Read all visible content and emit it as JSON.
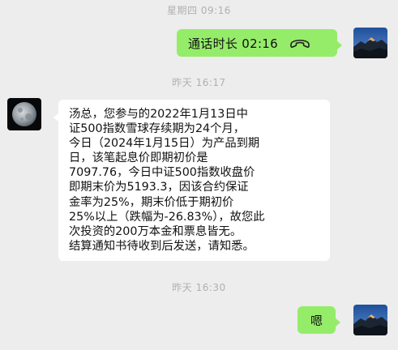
{
  "timestamps": [
    "星期四 09:16",
    "昨天 16:17",
    "昨天 16:30"
  ],
  "call": {
    "label": "通话时长 02:16",
    "icon": "phone-hangup-icon"
  },
  "incoming_message": {
    "lines": [
      "汤总，您参与的2022年1月13日中",
      "证500指数雪球存续期为24个月，",
      "今日（2024年1月15日）为产品到期",
      "日，该笔起息价即期初价是",
      "7097.76，今日中证500指数收盘价",
      "即期末价为5193.3，因该合约保证",
      "金率为25%，期末价低于期初价",
      "25%以上（跌幅为-26.83%），故您此",
      "次投资的200万本金和票息皆无。",
      "结算通知书待收到后发送，请知悉。"
    ]
  },
  "reply_message": {
    "text": "嗯"
  },
  "colors": {
    "background": "#ededed",
    "outgoing_bubble": "#95ec69",
    "incoming_bubble": "#ffffff",
    "timestamp": "#b0b0b0"
  },
  "avatars": {
    "self": "mountain-avatar",
    "contact": "moon-avatar"
  }
}
